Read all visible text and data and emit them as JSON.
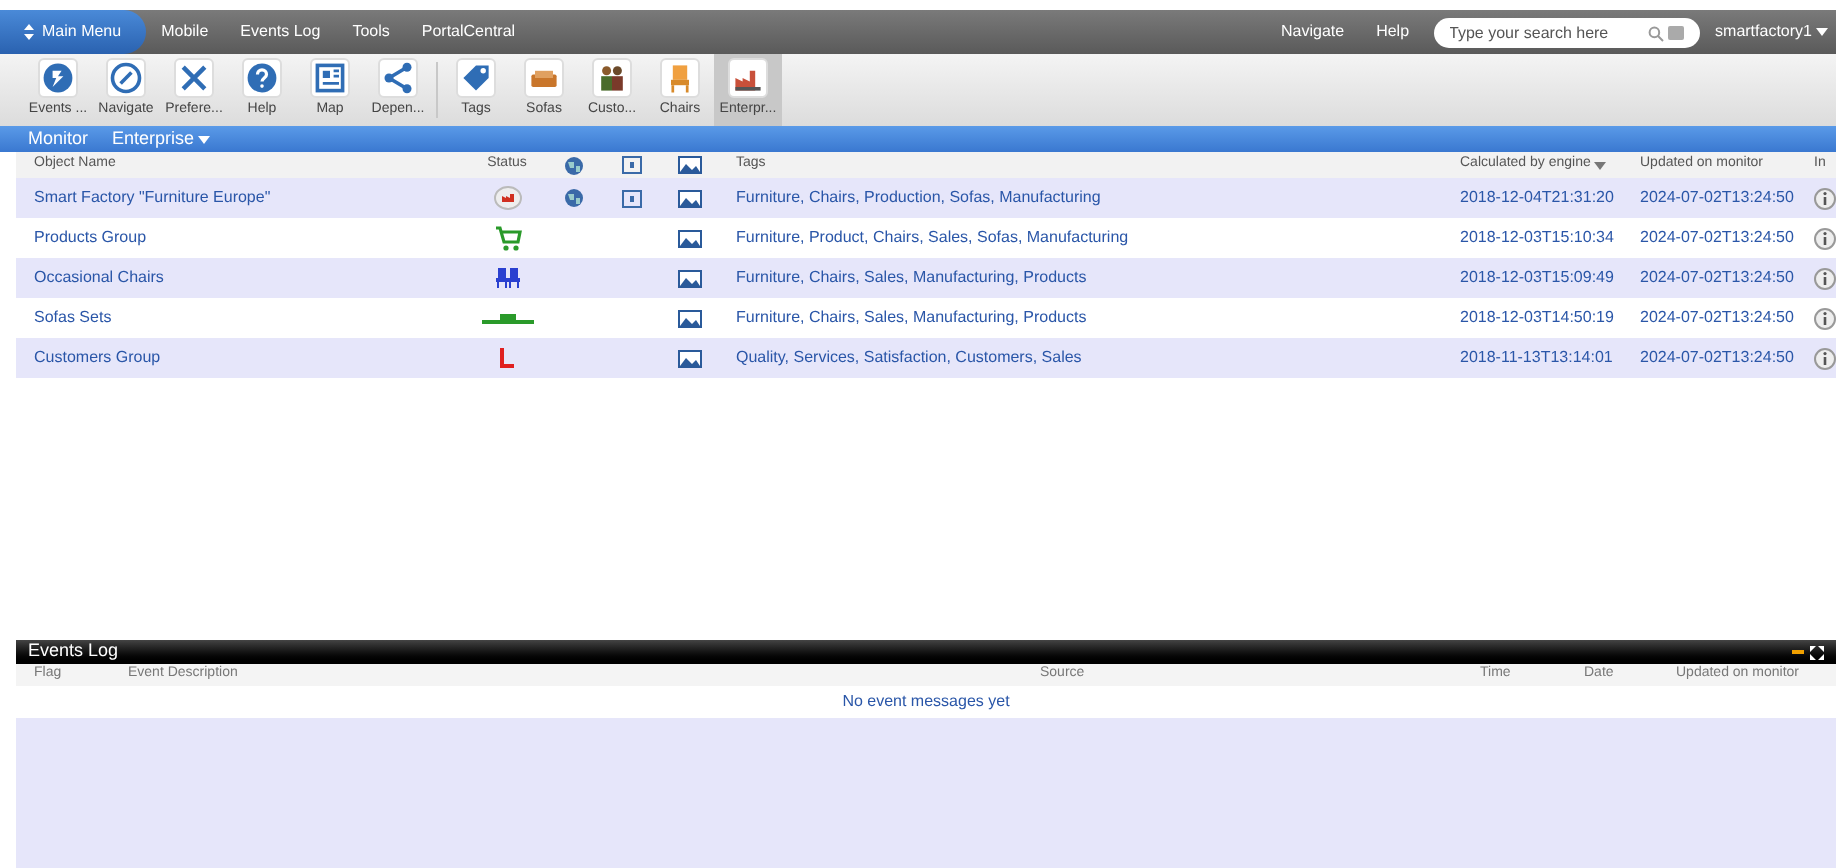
{
  "menu_bar": {
    "main_menu": "Main Menu",
    "items": [
      "Mobile",
      "Events Log",
      "Tools",
      "PortalCentral"
    ],
    "right_items": [
      "Navigate",
      "Help"
    ],
    "search": {
      "placeholder": "Type your search here"
    },
    "user": "smartfactory1"
  },
  "toolbar": [
    {
      "label": "Events ...",
      "kind": "events",
      "selected": false
    },
    {
      "label": "Navigate",
      "kind": "navigate",
      "selected": false
    },
    {
      "label": "Prefere...",
      "kind": "tools",
      "selected": false
    },
    {
      "label": "Help",
      "kind": "help",
      "selected": false
    },
    {
      "label": "Map",
      "kind": "map",
      "selected": false
    },
    {
      "label": "Depen...",
      "kind": "share",
      "selected": false
    },
    {
      "label": "Tags",
      "kind": "tag",
      "selected": false
    },
    {
      "label": "Sofas",
      "kind": "sofa",
      "selected": false
    },
    {
      "label": "Custo...",
      "kind": "people",
      "selected": false
    },
    {
      "label": "Chairs",
      "kind": "chair",
      "selected": false
    },
    {
      "label": "Enterpr...",
      "kind": "factory",
      "selected": true
    }
  ],
  "breadcrumb": {
    "title": "Monitor",
    "selector": "Enterprise"
  },
  "table": {
    "columns": [
      "Object Name",
      "Status",
      "Tags",
      "Calculated by engine",
      "Updated on monitor",
      "In"
    ],
    "rows": [
      {
        "name": "Smart Factory \"Furniture Europe\"",
        "kind": "factory",
        "globe": true,
        "panel": true,
        "tags": "Furniture, Chairs, Production, Sofas, Manufacturing",
        "calculated": "2018-12-04T21:31:20",
        "updated": "2024-07-02T13:24:50"
      },
      {
        "name": "Products Group",
        "kind": "cart",
        "globe": false,
        "panel": false,
        "tags": "Furniture, Product, Chairs, Sales, Sofas, Manufacturing",
        "calculated": "2018-12-03T15:10:34",
        "updated": "2024-07-02T13:24:50"
      },
      {
        "name": "Occasional Chairs",
        "kind": "chairs",
        "globe": false,
        "panel": false,
        "tags": "Furniture, Chairs, Sales, Manufacturing, Products",
        "calculated": "2018-12-03T15:09:49",
        "updated": "2024-07-02T13:24:50"
      },
      {
        "name": "Sofas Sets",
        "kind": "sofas",
        "globe": false,
        "panel": false,
        "tags": "Furniture, Chairs, Sales, Manufacturing, Products",
        "calculated": "2018-12-03T14:50:19",
        "updated": "2024-07-02T13:24:50"
      },
      {
        "name": "Customers Group",
        "kind": "chart",
        "globe": false,
        "panel": false,
        "tags": "Quality, Services, Satisfaction, Customers, Sales",
        "calculated": "2018-11-13T13:14:01",
        "updated": "2024-07-02T13:24:50"
      }
    ]
  },
  "events_log": {
    "title": "Events Log",
    "columns": [
      "Flag",
      "Event Description",
      "Source",
      "Time",
      "Date",
      "Updated on monitor"
    ],
    "empty_message": "No event messages yet"
  }
}
